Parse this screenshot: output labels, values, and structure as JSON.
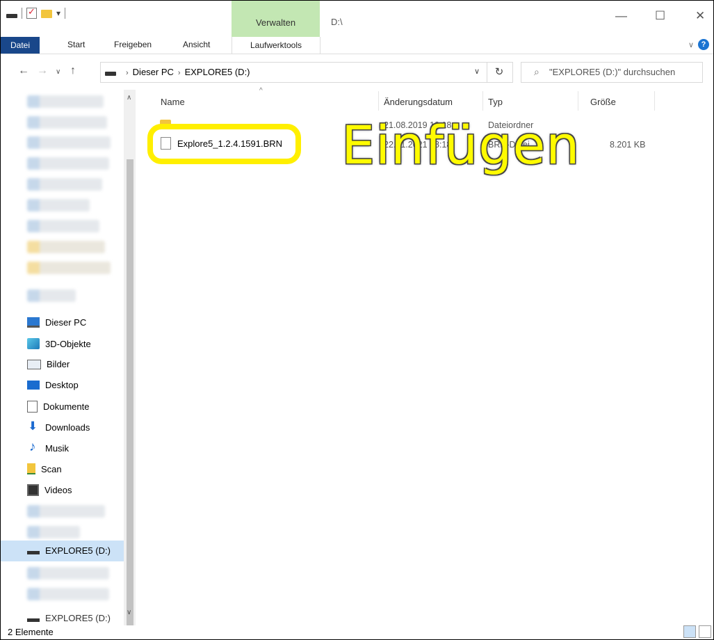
{
  "window": {
    "title_path": "D:\\",
    "context_tab": "Verwalten",
    "controls": [
      "—",
      "☐",
      "✕"
    ]
  },
  "ribbon": {
    "tabs": [
      "Datei",
      "Start",
      "Freigeben",
      "Ansicht",
      "Laufwerktools"
    ],
    "help_label": "?"
  },
  "address": {
    "crumbs": [
      "Dieser PC",
      "EXPLORE5 (D:)"
    ],
    "search_placeholder": "\"EXPLORE5 (D:)\" durchsuchen"
  },
  "nav": {
    "items": [
      {
        "label": "Dieser PC",
        "icon": "pc-icon"
      },
      {
        "label": "3D-Objekte",
        "icon": "cube-icon"
      },
      {
        "label": "Bilder",
        "icon": "pictures-icon"
      },
      {
        "label": "Desktop",
        "icon": "desktop-icon"
      },
      {
        "label": "Dokumente",
        "icon": "documents-icon"
      },
      {
        "label": "Downloads",
        "icon": "download-icon"
      },
      {
        "label": "Musik",
        "icon": "music-icon"
      },
      {
        "label": "Scan",
        "icon": "scan-icon"
      },
      {
        "label": "Videos",
        "icon": "video-icon"
      }
    ],
    "selected_drive": "EXPLORE5 (D:)",
    "bottom_drive": "EXPLORE5 (D:)"
  },
  "list": {
    "columns": [
      "Name",
      "Änderungsdatum",
      "Typ",
      "Größe"
    ],
    "rows": [
      {
        "name": "",
        "date": "21.08.2019 10:18",
        "type": "Dateiordner",
        "size": ""
      },
      {
        "name": "Explore5_1.2.4.1591.BRN",
        "date": "22.01.2021 08:18",
        "type": "BRN-Datei",
        "size": "8.201 KB"
      }
    ]
  },
  "overlay_text": "Einfügen",
  "status": {
    "count": "2 Elemente"
  },
  "colors": {
    "accent": "#19478a",
    "context_tab": "#c3e7b3",
    "highlight": "#ffef00"
  }
}
